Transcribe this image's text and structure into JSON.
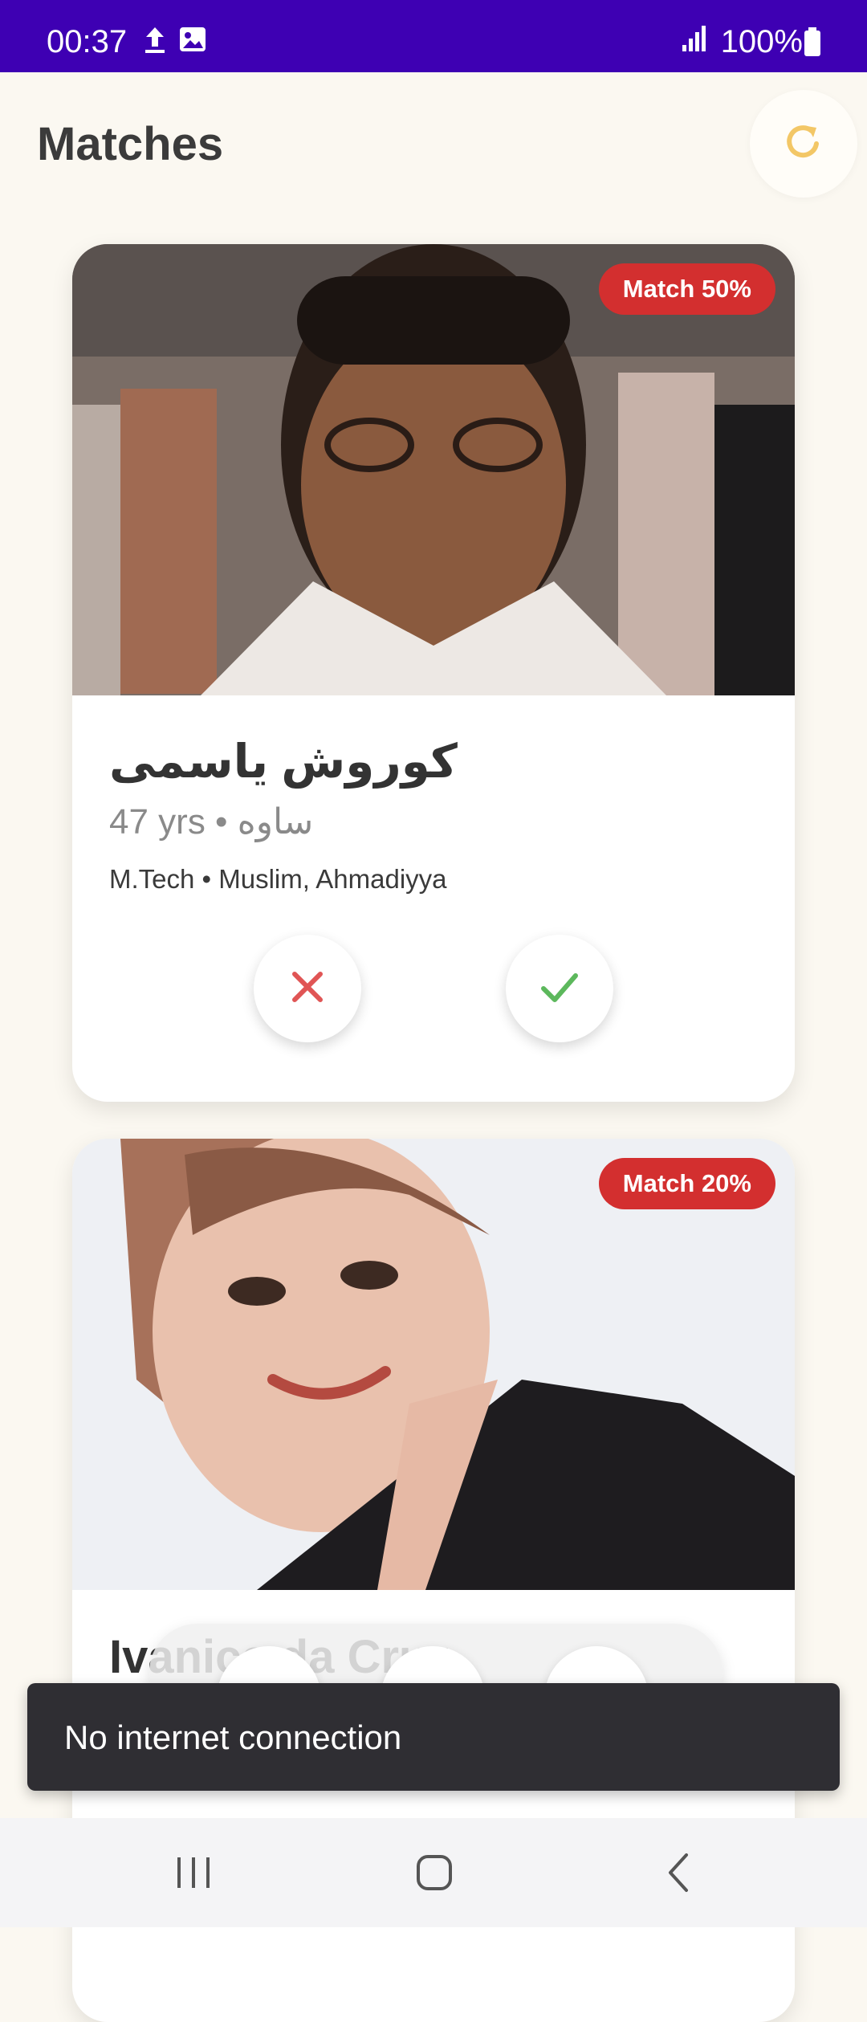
{
  "status_bar": {
    "time": "00:37",
    "battery": "100%",
    "icons": [
      "upload-icon",
      "image-icon",
      "signal-icon",
      "battery-icon"
    ]
  },
  "header": {
    "title": "Matches",
    "refresh_icon": "refresh-icon"
  },
  "cards": [
    {
      "match": "Match 50%",
      "name": "کوروش یاسمی",
      "meta": "47 yrs • ساوه",
      "education": "M.Tech • Muslim, Ahmadiyya",
      "reject_icon": "close-icon",
      "accept_icon": "check-icon"
    },
    {
      "match": "Match 20%",
      "name": "Ivanice da Cruz"
    }
  ],
  "snackbar": {
    "message": "No internet connection"
  },
  "nav": {
    "icons": [
      "recents-icon",
      "home-icon",
      "back-icon"
    ]
  },
  "colors": {
    "status_bar": "#3e00b3",
    "background": "#fbf8f1",
    "badge": "#d32f2f",
    "reject": "#e05555",
    "accept": "#5cb85c",
    "refresh": "#f3c766",
    "snackbar": "#2f2e33"
  }
}
